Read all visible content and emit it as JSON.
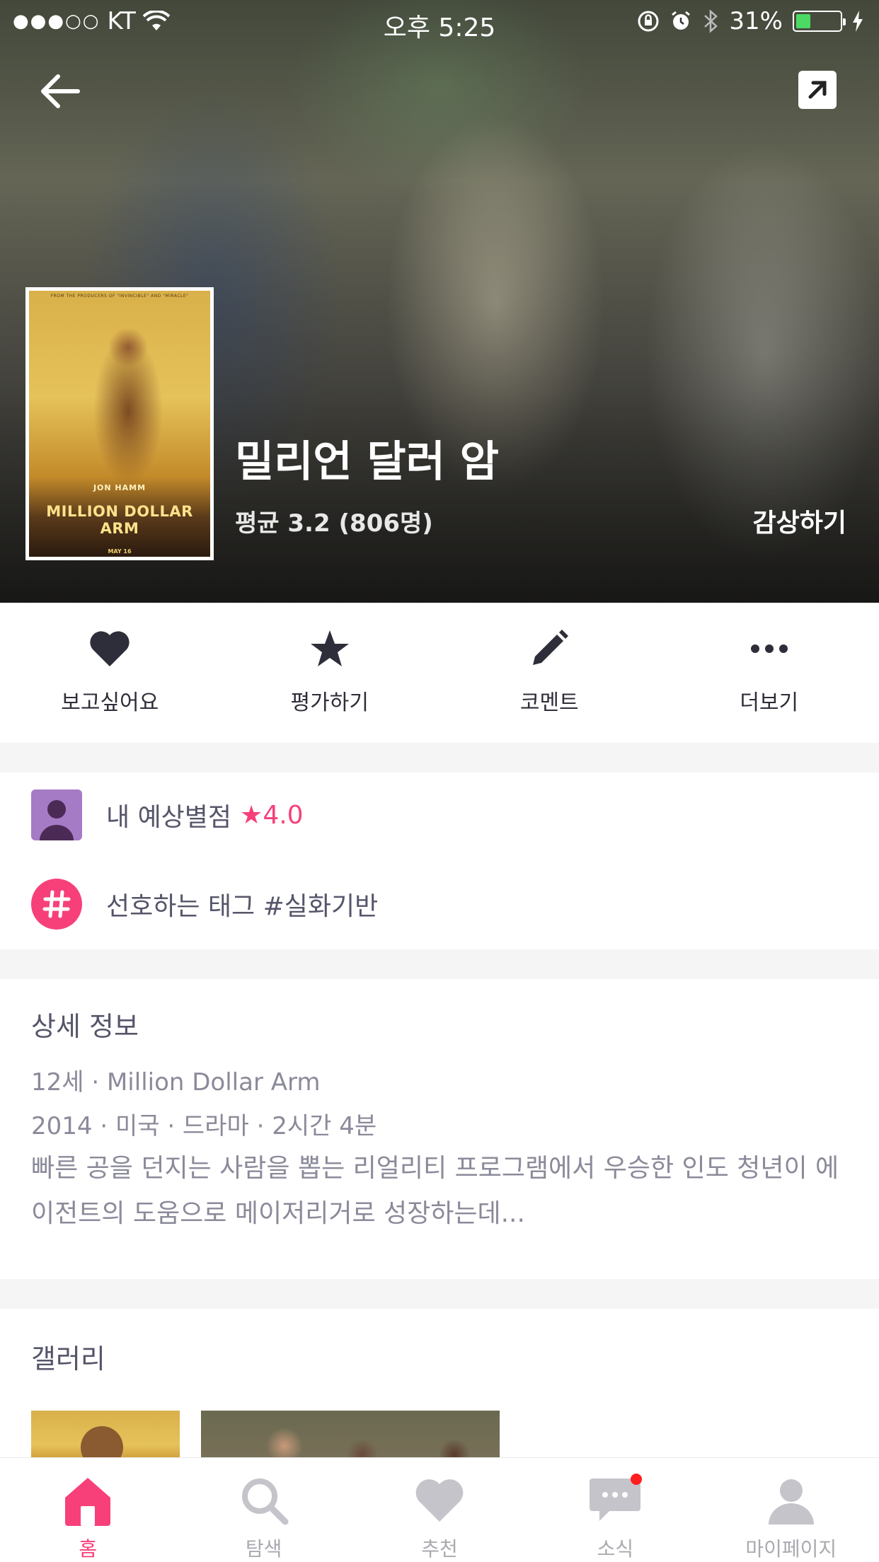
{
  "status_bar": {
    "signal_dots": "●●●○○",
    "carrier": "KT",
    "time": "오후 5:25",
    "battery_percent": "31%",
    "battery_level": 0.31
  },
  "hero": {
    "title": "밀리언 달러 암",
    "rating": "평균 3.2 (806명)",
    "watch_label": "감상하기",
    "poster": {
      "top_text": "FROM THE PRODUCERS OF \"INVINCIBLE\" AND \"MIRACLE\"",
      "actor": "JON HAMM",
      "title": "MILLION DOLLAR ARM",
      "date": "MAY 16"
    }
  },
  "actions": [
    {
      "label": "보고싶어요",
      "icon": "heart-icon"
    },
    {
      "label": "평가하기",
      "icon": "star-icon"
    },
    {
      "label": "코멘트",
      "icon": "pencil-icon"
    },
    {
      "label": "더보기",
      "icon": "more-icon"
    }
  ],
  "prefs": {
    "predicted_label": "내 예상별점",
    "predicted_value": "★4.0",
    "tag_label": "선호하는 태그 #실화기반"
  },
  "details": {
    "title": "상세 정보",
    "line1": "12세 · Million Dollar Arm",
    "line2": "2014 · 미국 · 드라마 · 2시간 4분",
    "synopsis": "빠른 공을 던지는 사람을 뽑는 리얼리티 프로그램에서 우승한 인도 청년이 에이전트의 도움으로 메이저리거로 성장하는데..."
  },
  "gallery": {
    "title": "갤러리"
  },
  "tabs": [
    {
      "label": "홈",
      "icon": "home-icon",
      "active": true
    },
    {
      "label": "탐색",
      "icon": "search-icon",
      "active": false
    },
    {
      "label": "추천",
      "icon": "heart-icon",
      "active": false
    },
    {
      "label": "소식",
      "icon": "chat-icon",
      "active": false,
      "notification": true
    },
    {
      "label": "마이페이지",
      "icon": "person-icon",
      "active": false
    }
  ],
  "colors": {
    "accent": "#f7407a",
    "inactive_tab": "#aaaab0",
    "icon_dark": "#2e2e3a"
  }
}
